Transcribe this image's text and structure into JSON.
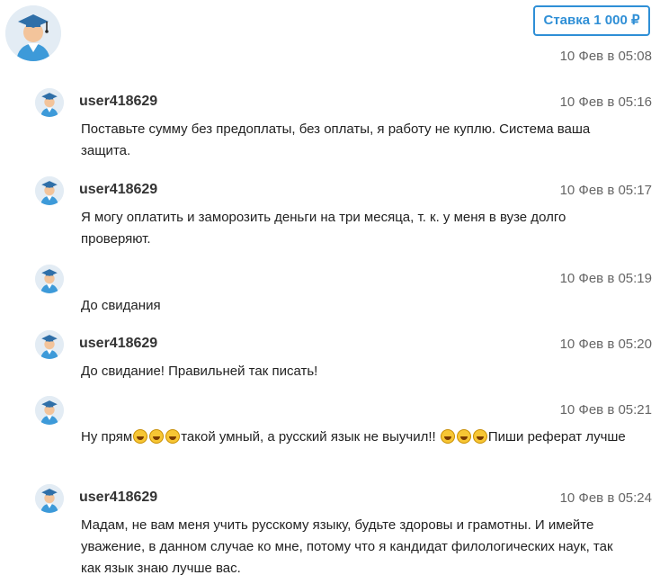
{
  "header": {
    "bid_label": "Ставка 1 000 ₽",
    "time": "10 Фев в 05:08"
  },
  "messages": [
    {
      "user": "user418629",
      "time": "10 Фев в 05:16",
      "text": "Поставьте сумму без предоплаты, без оплаты, я работу не куплю. Система ваша защита."
    },
    {
      "user": "user418629",
      "time": "10 Фев в 05:17",
      "text": "Я могу оплатить и заморозить деньги на три месяца, т. к. у меня в вузе долго проверяют."
    },
    {
      "user": "",
      "time": "10 Фев в 05:19",
      "text": "До свидания"
    },
    {
      "user": "user418629",
      "time": "10 Фев в 05:20",
      "text": "До свидание! Правильней так писать!"
    },
    {
      "user": "",
      "time": "10 Фев в 05:21",
      "text_a": "Ну прям",
      "text_b": "такой умный, а русский язык не выучил!! ",
      "text_c": "Пиши реферат лучше"
    },
    {
      "user": "user418629",
      "time": "10 Фев в 05:24",
      "text": "Мадам, не вам меня учить русскому языку, будьте здоровы и грамотны. И имейте уважение, в данном случае ко мне, потому что я кандидат филологических наук, так как язык знаю лучше вас."
    }
  ],
  "icons": {
    "avatar": "graduate-avatar-icon",
    "emoji": "rolling-laughing-emoji-icon"
  }
}
